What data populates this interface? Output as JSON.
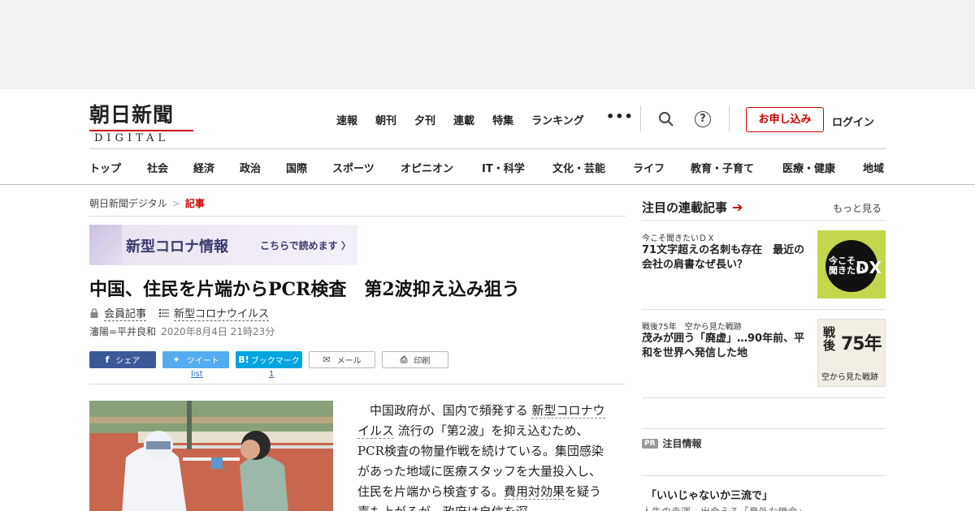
{
  "header": {
    "logo_jp": "朝日新聞",
    "logo_en": "DIGITAL",
    "top_nav": [
      "速報",
      "朝刊",
      "夕刊",
      "連載",
      "特集",
      "ランキング"
    ],
    "more": "•••",
    "help": "?",
    "apply_button": "お申し込み",
    "login": "ログイン",
    "categories": [
      "トップ",
      "社会",
      "経済",
      "政治",
      "国際",
      "スポーツ",
      "オピニオン",
      "IT・科学",
      "文化・芸能",
      "ライフ",
      "教育・子育て",
      "医療・健康",
      "地域"
    ]
  },
  "breadcrumb": {
    "home": "朝日新聞デジタル",
    "sep": ">",
    "current": "記事"
  },
  "banner": {
    "main": "新型コロナ情報",
    "sub": "こちらで読めます 〉"
  },
  "article": {
    "title": "中国、住民を片端からPCR検査　第2波抑え込み狙う",
    "member_label": "会員記事",
    "topic": "新型コロナウイルス",
    "byline": "瀋陽=平井良和",
    "date": "2020年8月4日 21時23分",
    "body_pre": "　中国政府が、国内で頻発する ",
    "body_link1": "新型コロナウイルス",
    "body_mid": " 流行の「第2波」を抑え込むため、PCR検査の物量作戦を続けている。集団感染があった地域に医療スタッフを大量投入し、住民を片端から検査する。",
    "body_link2": "費用対効果",
    "body_post": "を疑う声も上がるが、政府は自信を深"
  },
  "share": {
    "facebook": "シェア",
    "twitter": "ツイート",
    "twitter_count": "list",
    "hatena": "ブックマーク",
    "hatena_icon": "B!",
    "hatena_count": "1",
    "mail": "メール",
    "print": "印刷"
  },
  "sidebar": {
    "heading": "注目の連載記事",
    "more": "もっと見る",
    "items": [
      {
        "kicker": "今こそ聞きたいＤＸ",
        "title": "71文字超えの名刺も存在　最近の会社の肩書なぜ長い？",
        "thumb_text1": "今こそ",
        "thumb_text2": "聞きたい",
        "thumb_text3": "DX"
      },
      {
        "kicker": "戦後75年　空から見た戦跡",
        "title": "茂みが囲う「廃虚」…90年前、平和を世界へ発信した地",
        "thumb_text1": "戦",
        "thumb_text2": "後",
        "thumb_text3": "75年",
        "thumb_caption": "空から見た戦跡"
      }
    ],
    "pr_badge": "PR",
    "pr_heading": "注目情報",
    "pr_item": "「いいじゃないか三流で」",
    "pr_sub": "人生の幸運、出会える「意外な機会」"
  },
  "colors": {
    "brand_red": "#cc0000",
    "facebook": "#3b5998",
    "twitter": "#55acee",
    "hatena": "#00a4de"
  }
}
